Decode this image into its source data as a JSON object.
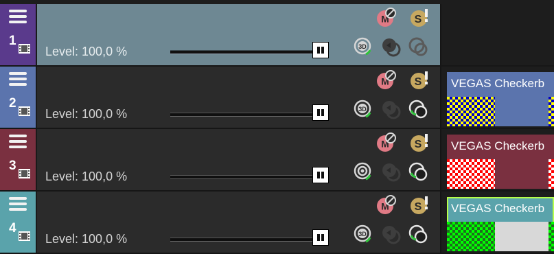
{
  "tracks": [
    {
      "number": "1",
      "color": "#5a3a8c",
      "selected": true,
      "level_label": "Level: 100,0 %",
      "level_percent": 100,
      "buttons": {
        "row1": [
          "mute-icon",
          "solo-icon"
        ],
        "row2": [
          "3d-icon",
          "composite-mode-icon",
          "motion-blur-icon"
        ]
      },
      "row2_state": [
        "enabled",
        "disabled",
        "disabled"
      ],
      "clip": null
    },
    {
      "number": "2",
      "color": "#5b74ad",
      "selected": false,
      "level_label": "Level: 100,0 %",
      "level_percent": 100,
      "buttons": {
        "row1": [
          "mute-icon",
          "solo-icon"
        ],
        "row2": [
          "3d-icon",
          "composite-mode-icon",
          "motion-blur-icon"
        ]
      },
      "row2_state": [
        "enabled",
        "disabled",
        "enabled"
      ],
      "clip": {
        "title": "VEGAS Checkerb",
        "color": "#5b74ad",
        "pattern_a": "#ffff00",
        "pattern_b": "#0000c8"
      }
    },
    {
      "number": "3",
      "color": "#7a3040",
      "selected": false,
      "level_label": "Level: 100,0 %",
      "level_percent": 100,
      "buttons": {
        "row1": [
          "mute-icon",
          "solo-icon"
        ],
        "row2": [
          "composite-icon",
          "composite-mode-icon",
          "motion-blur-icon"
        ]
      },
      "row2_state": [
        "enabled",
        "disabled",
        "enabled"
      ],
      "clip": {
        "title": "VEGAS Checkerb",
        "color": "#7a3040",
        "pattern_a": "#ff0000",
        "pattern_b": "#ffffff"
      }
    },
    {
      "number": "4",
      "color": "#5aa3ab",
      "selected": false,
      "level_label": "Level: 100,0 %",
      "level_percent": 100,
      "buttons": {
        "row1": [
          "mute-icon",
          "solo-icon"
        ],
        "row2": [
          "3d-icon",
          "composite-mode-icon",
          "motion-blur-icon"
        ]
      },
      "row2_state": [
        "enabled",
        "disabled",
        "enabled"
      ],
      "clip": {
        "title": "VEGAS Checkerb",
        "color": "#5aa3ab",
        "pattern_a": "#00ff00",
        "pattern_b": "#1f6b1f"
      }
    }
  ]
}
